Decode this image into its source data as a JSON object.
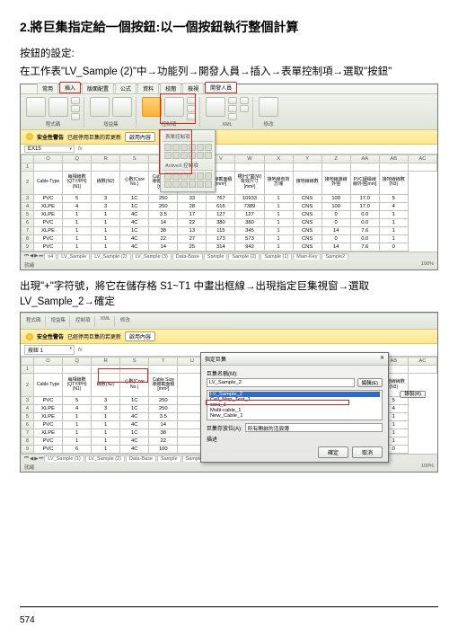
{
  "heading": "2.將巨集指定給一個按鈕:以一個按鈕執行整個計算",
  "para1": "按鈕的設定:",
  "para2": "在工作表\"LV_Sample (2)\"中→功能列→開發人員→插入→表單控制項→選取\"按鈕\"",
  "para3": "出現\"+\"字符號，將它在儲存格 S1~T1 中畫出框線→出現指定巨集視窗→選取 LV_Sample_2→確定",
  "page": "574",
  "tabs1": [
    "常用",
    "插入",
    "版面配置",
    "公式",
    "資料",
    "校閱",
    "檢視",
    "開發人員"
  ],
  "ribbon_groups": [
    "程式碼",
    "增益集",
    "控制項",
    "XML",
    "修改"
  ],
  "ribbon_icons": {
    "vb": "Visual Basic",
    "macro": "巨集",
    "addin": "增益集",
    "com": "COM 增益集",
    "insert": "插入",
    "design": "設計模式",
    "src": "來源"
  },
  "yellow": {
    "label": "安全性警告",
    "msg": "已經停用巨集的若更新",
    "btn": "啟用內容"
  },
  "namebox1": "EX15",
  "dropdown": {
    "title": "表單控制項",
    "active": "ActiveX 控制項"
  },
  "cols1": [
    "O",
    "Q",
    "R",
    "S",
    "T",
    "U",
    "V",
    "W",
    "X",
    "Y",
    "Z",
    "AA",
    "AB",
    "AC"
  ],
  "hdrs1": [
    "Cable Type",
    "每相線數(QTY/PH)(N1)",
    "線數(N2)",
    "心數(Core No.)",
    "Cable Size 導體截面積[mm²]",
    "Cable O.D 纜線外徑[mm]",
    "物線截面積[mm²]",
    "槽(H)*寬(W)有效尺寸[mm²]",
    "接地線有效方塊",
    "接地線線數",
    "接地線導線外徑",
    "PVC絕緣線線外徑[mm]",
    "接地線線數(N3)"
  ],
  "rows1": [
    [
      "PVC",
      "5",
      "3",
      "1C",
      "250",
      "33",
      "767",
      "10933",
      "1",
      "CNS",
      "100",
      "17.0",
      "5"
    ],
    [
      "XLPE",
      "4",
      "3",
      "1C",
      "250",
      "28",
      "616",
      "7389",
      "1",
      "CNS",
      "100",
      "17.0",
      "4"
    ],
    [
      "XLPE",
      "1",
      "1",
      "4C",
      "3.5",
      "17",
      "127",
      "127",
      "1",
      "CNS",
      "0",
      "0.0",
      "1"
    ],
    [
      "PVC",
      "1",
      "1",
      "4C",
      "14",
      "22",
      "380",
      "380",
      "1",
      "CNS",
      "0",
      "0.0",
      "1"
    ],
    [
      "XLPE",
      "1",
      "1",
      "1C",
      "38",
      "13",
      "115",
      "345",
      "1",
      "CNS",
      "14",
      "7.6",
      "1"
    ],
    [
      "PVC",
      "1",
      "1",
      "4C",
      "22",
      "27",
      "173",
      "573",
      "1",
      "CNS",
      "0",
      "0.0",
      "1"
    ],
    [
      "PVC",
      "1",
      "1",
      "4C",
      "14",
      "25",
      "314",
      "942",
      "1",
      "CNS",
      "14",
      "7.6",
      "0"
    ]
  ],
  "sheettabs1": [
    "s4",
    "LV_Sample",
    "LV_Sample (2)",
    "LV_Sample (3)",
    "Data-Base",
    "Sample",
    "Sample (2)",
    "Sample (1)",
    "Main-Key",
    "Sample2"
  ],
  "status1": {
    "left": "就緒",
    "right": "100%"
  },
  "namebox2": "按鈕 1",
  "cols2": [
    "O",
    "Q",
    "R",
    "S",
    "T",
    "U",
    "V",
    "W",
    "X",
    "Y",
    "Z",
    "AA",
    "AB",
    "AC"
  ],
  "hdrs2": [
    "Cable Type",
    "每相線數(QTY/PH)(N1)",
    "線數(N2)",
    "心數(Core No.)",
    "Cable Size 導體截面積[mm²]",
    "",
    "",
    "",
    "",
    "",
    "",
    "",
    "接地線線數(N3)"
  ],
  "rows2": [
    [
      "PVC",
      "5",
      "3",
      "1C",
      "250",
      "",
      "",
      "",
      "",
      "",
      "",
      "",
      "5"
    ],
    [
      "XLPE",
      "4",
      "3",
      "1C",
      "250",
      "",
      "",
      "",
      "",
      "",
      "",
      "",
      "4"
    ],
    [
      "XLPE",
      "1",
      "1",
      "4C",
      "3.5",
      "",
      "",
      "",
      "",
      "",
      "",
      "",
      "1"
    ],
    [
      "PVC",
      "1",
      "1",
      "4C",
      "14",
      "",
      "",
      "",
      "",
      "",
      "",
      "",
      "1"
    ],
    [
      "XLPE",
      "1",
      "1",
      "1C",
      "38",
      "",
      "",
      "",
      "",
      "",
      "",
      "",
      "1"
    ],
    [
      "PVC",
      "1",
      "1",
      "4C",
      "22",
      "",
      "",
      "",
      "",
      "",
      "",
      "",
      "1"
    ],
    [
      "PVC",
      "6",
      "1",
      "4C",
      "100",
      "",
      "",
      "",
      "",
      "",
      "",
      "",
      "0"
    ]
  ],
  "dialog": {
    "title": "指定巨集",
    "name_label": "巨集名稱(M):",
    "name_value": "LV_Sample_2",
    "list": [
      "LV_Sample_2",
      "Cell_Map_Test_1",
      "cora_1",
      "Multi-cable_1",
      "New_Cable_1"
    ],
    "from_label": "巨集存放位(A):",
    "from_value": "所有開啟的活頁簿",
    "desc_label": "描述",
    "btn_edit": "編輯(E)",
    "btn_rec": "錄製(R)",
    "btn_ok": "確定",
    "btn_cancel": "取消"
  },
  "sheettabs2": [
    "LV_Sample (1)",
    "LV_Sample (2)",
    "Data-Base",
    "Sample",
    "Sample (2)",
    "Sample (1)",
    "Main-Key",
    "Sample2"
  ]
}
